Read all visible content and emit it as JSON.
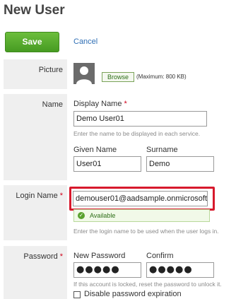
{
  "page": {
    "title": "New User"
  },
  "toolbar": {
    "save_label": "Save",
    "cancel_label": "Cancel"
  },
  "picture": {
    "label": "Picture",
    "browse_label": "Browse",
    "max_note": "(Maximum: 800 KB)"
  },
  "name": {
    "label": "Name",
    "display_name_label": "Display Name",
    "display_name_value": "Demo User01",
    "display_name_hint": "Enter the name to be displayed in each service.",
    "given_name_label": "Given Name",
    "given_name_value": "User01",
    "surname_label": "Surname",
    "surname_value": "Demo"
  },
  "login": {
    "label": "Login Name",
    "value": "demouser01@aadsample.onmicrosoft",
    "status": "Available",
    "hint": "Enter the login name to be used when the user logs in."
  },
  "password": {
    "label": "Password",
    "new_label": "New Password",
    "new_value": "●●●●●",
    "confirm_label": "Confirm",
    "confirm_value": "●●●●●",
    "hint": "If this account is locked, reset the password to unlock it.",
    "disable_expiration_label": "Disable password expiration"
  },
  "required_mark": "*",
  "colors": {
    "accent_green": "#469b22",
    "link_blue": "#2f6fb5",
    "highlight_red": "#d7192c",
    "required_red": "#d0021b"
  }
}
